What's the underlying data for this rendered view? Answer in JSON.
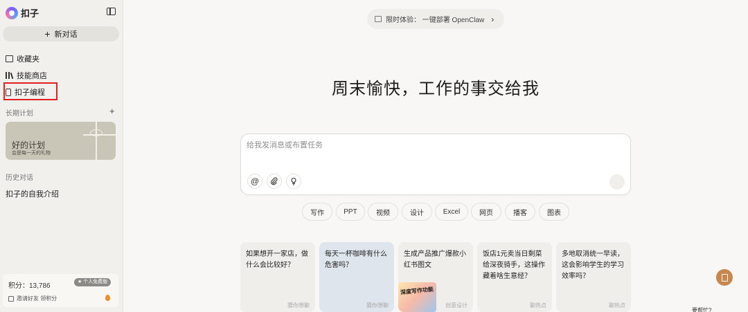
{
  "sidebar": {
    "brand": "扣子",
    "new_chat": "新对话",
    "nav": [
      "收藏夹",
      "技能商店",
      "扣子编程"
    ],
    "plans_title": "长期计划",
    "plan_card": {
      "title": "好的计划",
      "subtitle": "会是每一天的礼物"
    },
    "history_title": "历史对话",
    "history_items": [
      "扣子的自我介绍"
    ],
    "points_label": "积分：13,786",
    "badge": "★ 个人免费版",
    "invite": "邀请好友 领积分"
  },
  "main": {
    "promo": "限时体验：  一键部署 OpenClaw",
    "headline": "周末愉快，工作的事交给我",
    "composer_placeholder": "给我发消息或布置任务",
    "tools": [
      "@",
      "attach-icon",
      "lightbulb-icon"
    ],
    "chips": [
      "写作",
      "PPT",
      "视频",
      "设计",
      "Excel",
      "网页",
      "播客",
      "图表"
    ],
    "cards": [
      {
        "text": "如果想开一家店，做什么会比较好？",
        "tag": "猜你想聊"
      },
      {
        "text": "每天一杯咖啡有什么危害吗？",
        "tag": "猜你想聊"
      },
      {
        "text": "生成产品推广爆款小红书图文",
        "tag": "创意设计",
        "thumb": "深度写作功能"
      },
      {
        "text": "饭店1元卖当日剩菜给深夜骑手，这操作藏着啥生意经？",
        "tag": "聊热点"
      },
      {
        "text": "多地取消统一早读，这会影响学生的学习效率吗？",
        "tag": "聊热点"
      }
    ],
    "help": "要帮忙?"
  },
  "colors": {
    "highlight": "#e02020",
    "accent": "#c8874e"
  }
}
